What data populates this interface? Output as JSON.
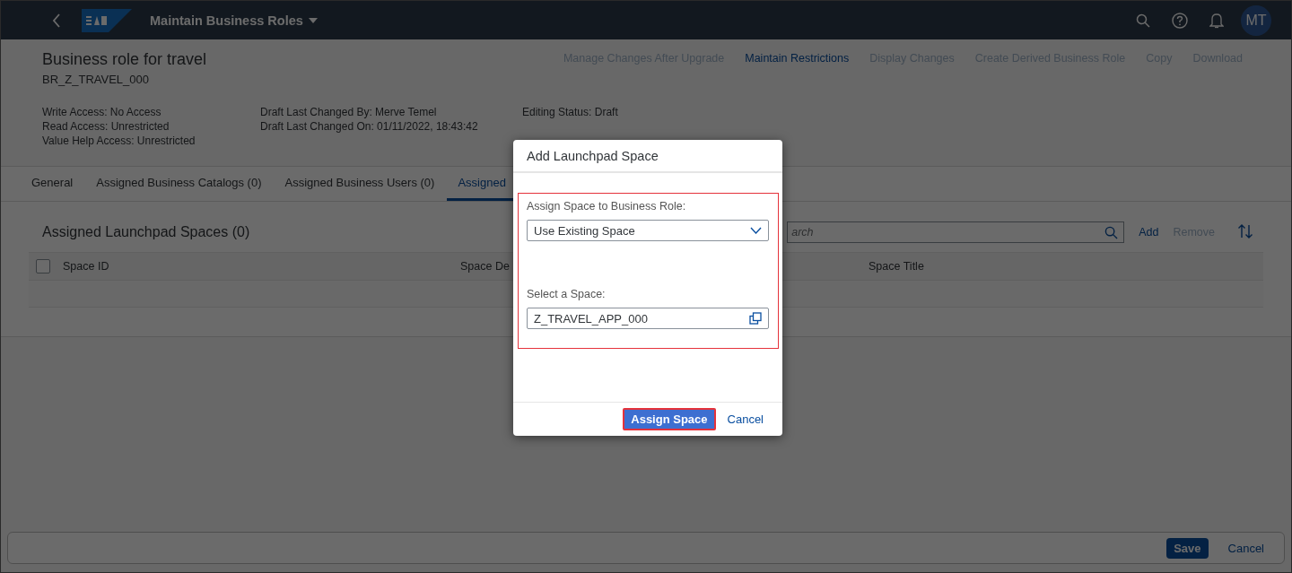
{
  "shell": {
    "title": "Maintain Business Roles",
    "avatar": "MT"
  },
  "header": {
    "title": "Business role for travel",
    "id": "BR_Z_TRAVEL_000",
    "actions": [
      {
        "label": "Manage Changes After Upgrade",
        "disabled": true
      },
      {
        "label": "Maintain Restrictions",
        "disabled": false
      },
      {
        "label": "Display Changes",
        "disabled": true
      },
      {
        "label": "Create Derived Business Role",
        "disabled": true
      },
      {
        "label": "Copy",
        "disabled": true
      },
      {
        "label": "Download",
        "disabled": true
      }
    ],
    "attribute_columns": [
      [
        "Write Access: No Access",
        "Read Access: Unrestricted",
        "Value Help Access: Unrestricted"
      ],
      [
        "Draft Last Changed By: Merve Temel",
        "Draft Last Changed On: 01/11/2022, 18:43:42"
      ],
      [
        "Editing Status: Draft"
      ]
    ]
  },
  "tabs": [
    {
      "label": "General",
      "selected": false
    },
    {
      "label": "Assigned Business Catalogs (0)",
      "selected": false
    },
    {
      "label": "Assigned Business Users (0)",
      "selected": false
    },
    {
      "label": "Assigned",
      "selected": true
    }
  ],
  "section": {
    "title": "Assigned Launchpad Spaces (0)",
    "search": {
      "placeholder": "arch"
    },
    "toolbar": [
      {
        "label": "Add",
        "disabled": false
      },
      {
        "label": "Remove",
        "disabled": true
      }
    ],
    "table": {
      "select_all": {
        "checked": false
      },
      "columns": [
        "Space ID",
        "Space De",
        "Space Title"
      ]
    }
  },
  "dialog": {
    "title": "Add Launchpad Space",
    "fields": [
      {
        "kind": "select",
        "label": "Assign Space to Business Role:",
        "value": "Use Existing Space"
      },
      {
        "kind": "valuehelp",
        "label": "Select a Space:",
        "value": "Z_TRAVEL_APP_000"
      }
    ],
    "buttons": [
      {
        "label": "Assign Space",
        "emphasized": true
      },
      {
        "label": "Cancel",
        "emphasized": false
      }
    ]
  },
  "footer": {
    "buttons": [
      {
        "label": "Save",
        "emphasized": true
      },
      {
        "label": "Cancel",
        "emphasized": false
      }
    ]
  }
}
